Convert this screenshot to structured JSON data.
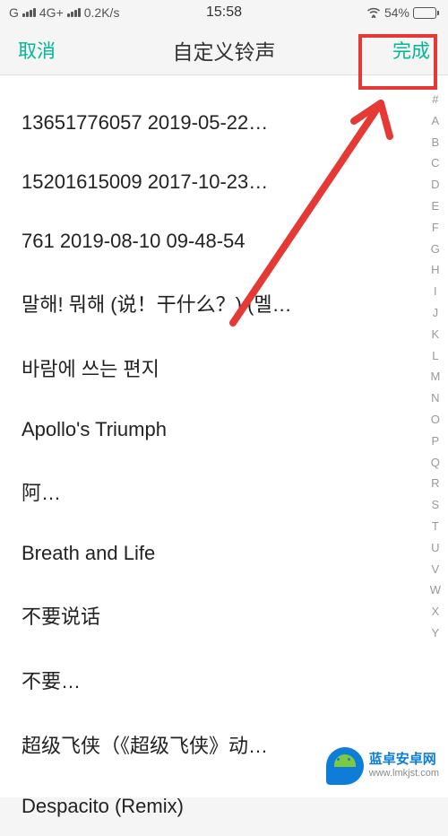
{
  "status_bar": {
    "carrier": "G",
    "network": "4G+",
    "speed": "0.2K/s",
    "time": "15:58",
    "battery_pct": "54%"
  },
  "nav": {
    "cancel": "取消",
    "title": "自定义铃声",
    "done": "完成"
  },
  "songs": [
    "13651776057 2019-05-22…",
    "15201615009 2017-10-23…",
    "761 2019-08-10 09-48-54",
    "말해! 뭐해 (说！干什么？) (멜…",
    "바람에 쓰는 편지",
    "Apollo's Triumph",
    "阿…",
    "Breath and Life",
    "不要说话",
    "不要…",
    "超级飞侠（《超级飞侠》动…",
    "Despacito (Remix)"
  ],
  "index_letters": [
    "#",
    "A",
    "B",
    "C",
    "D",
    "E",
    "F",
    "G",
    "H",
    "I",
    "J",
    "K",
    "L",
    "M",
    "N",
    "O",
    "P",
    "Q",
    "R",
    "S",
    "T",
    "U",
    "V",
    "W",
    "X",
    "Y"
  ],
  "watermark": {
    "line1": "蓝卓安卓网",
    "line2": "www.lmkjst.com"
  }
}
